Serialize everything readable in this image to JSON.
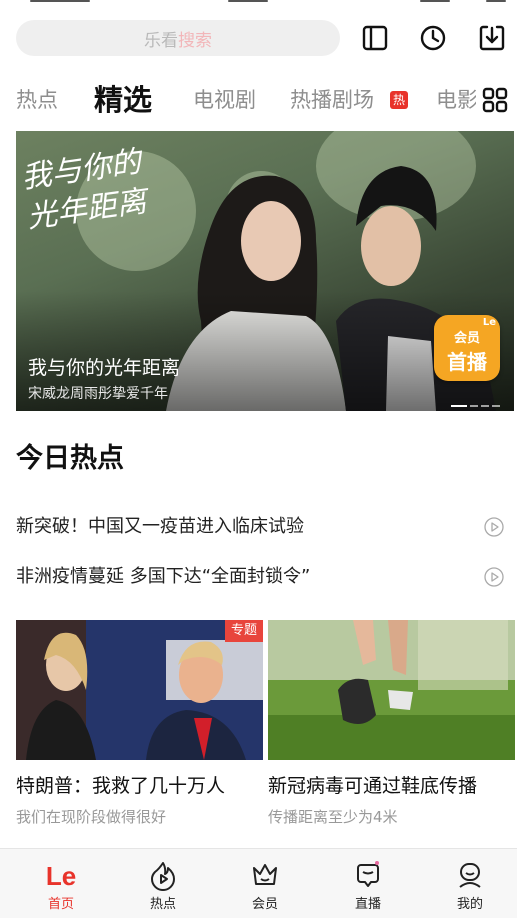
{
  "search": {
    "placeholder_part1": "乐看",
    "placeholder_part2": "搜索"
  },
  "tabs": [
    {
      "label": "热点"
    },
    {
      "label": "精选"
    },
    {
      "label": "电视剧"
    },
    {
      "label": "热播剧场"
    },
    {
      "label": "电影"
    }
  ],
  "hot_badge": "热",
  "banner": {
    "title": "我与你的光年距离",
    "subtitle": "宋威龙周雨彤挚爱千年",
    "logo_text": "我与你的光年距离",
    "badge_line1": "会员",
    "badge_line2": "首播",
    "badge_brand": "Le"
  },
  "section": {
    "title": "今日热点"
  },
  "news": [
    {
      "text": "新突破！中国又一疫苗进入临床试验"
    },
    {
      "text": "非洲疫情蔓延 多国下达“全面封锁令”"
    }
  ],
  "cards": [
    {
      "title": "特朗普：我救了几十万人",
      "subtitle": "我们在现阶段做得很好",
      "tag": "专题"
    },
    {
      "title": "新冠病毒可通过鞋底传播",
      "subtitle": "传播距离至少为4米",
      "tag": ""
    }
  ],
  "nav": {
    "logo": "Le",
    "items": [
      {
        "label": "首页",
        "icon": "le-logo-icon"
      },
      {
        "label": "热点",
        "icon": "flame-icon"
      },
      {
        "label": "会员",
        "icon": "crown-icon"
      },
      {
        "label": "直播",
        "icon": "live-icon"
      },
      {
        "label": "我的",
        "icon": "profile-icon"
      }
    ]
  },
  "colors": {
    "accent": "#e8332b",
    "badge": "#f5a623"
  }
}
